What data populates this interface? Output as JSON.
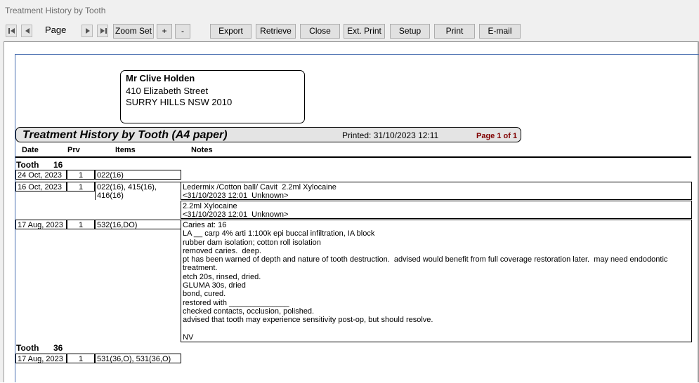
{
  "window": {
    "title": "Treatment History by Tooth"
  },
  "toolbar": {
    "page_label": "Page",
    "zoom_set": "Zoom Set",
    "zoom_in": "+",
    "zoom_out": "-",
    "export": "Export",
    "retrieve": "Retrieve",
    "close": "Close",
    "ext_print": "Ext. Print",
    "setup": "Setup",
    "print": "Print",
    "email": "E-mail"
  },
  "patient": {
    "name": "Mr Clive  Holden",
    "address1": "410 Elizabeth Street",
    "address2": "SURRY HILLS NSW 2010"
  },
  "report": {
    "title": "Treatment History by Tooth (A4 paper)",
    "printed": "Printed: 31/10/2023 12:11",
    "page": "Page 1 of 1"
  },
  "columns": {
    "date": "Date",
    "prv": "Prv",
    "items": "Items",
    "notes": "Notes"
  },
  "groups": [
    {
      "tooth_label": "Tooth",
      "tooth_no": "16",
      "rows": [
        {
          "date": "24 Oct, 2023",
          "prv": "1",
          "items": "022(16)",
          "notes": []
        },
        {
          "date": "16 Oct, 2023",
          "prv": "1",
          "items": "022(16), 415(16), 416(16)",
          "notes": [
            "Ledermix /Cotton ball/ Cavit  2.2ml Xylocaine\n<31/10/2023 12:01  Unknown>",
            "2.2ml Xylocaine\n<31/10/2023 12:01  Unknown>"
          ]
        },
        {
          "date": "17 Aug, 2023",
          "prv": "1",
          "items": "532(16,DO)",
          "notes": [
            "Caries at: 16\nLA __ carp 4% arti 1:100k epi buccal infiltration, IA block\nrubber dam isolation; cotton roll isolation\nremoved caries.  deep.\npt has been warned of depth and nature of tooth destruction.  advised would benefit from full coverage restoration later.  may need endodontic treatment.\netch 20s, rinsed, dried.\nGLUMA 30s, dried\nbond, cured.\nrestored with ______________\nchecked contacts, occlusion, polished.\nadvised that tooth may experience sensitivity post-op, but should resolve.\n\nNV"
          ]
        }
      ]
    },
    {
      "tooth_label": "Tooth",
      "tooth_no": "36",
      "rows": [
        {
          "date": "17 Aug, 2023",
          "prv": "1",
          "items": "531(36,O), 531(36,O)",
          "notes": []
        }
      ]
    }
  ]
}
